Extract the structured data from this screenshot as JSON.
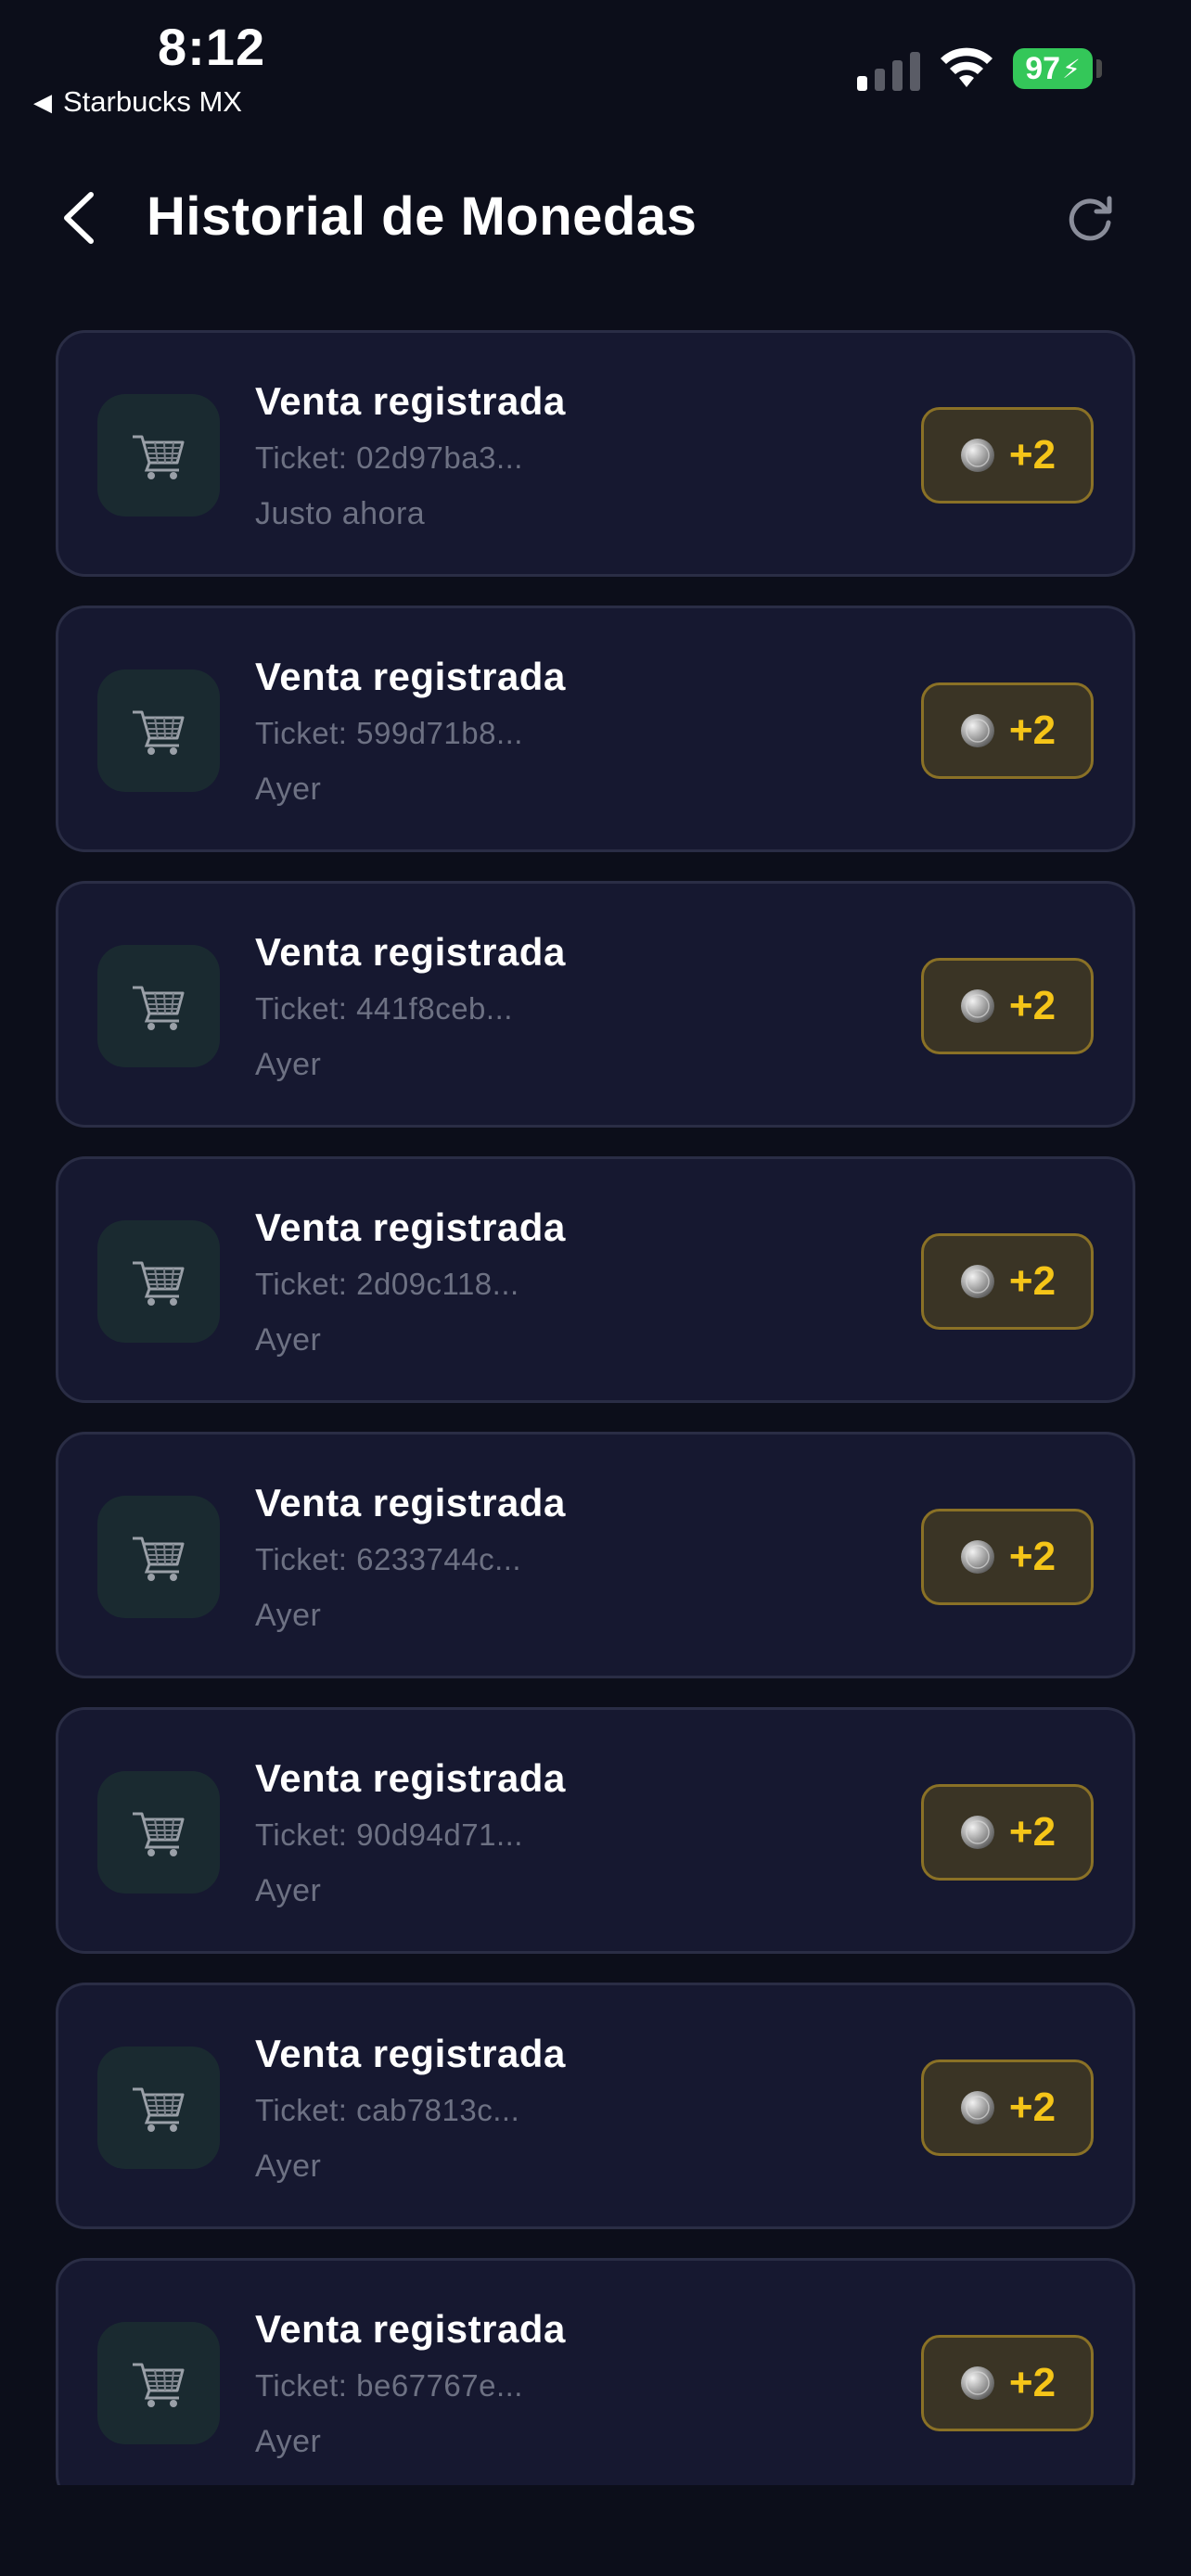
{
  "status_bar": {
    "time": "8:12",
    "back_app": "Starbucks MX",
    "battery": "97",
    "colors": {
      "battery": "#34c759"
    }
  },
  "header": {
    "title": "Historial de Monedas",
    "back_icon": "chevron-left-icon",
    "refresh_icon": "refresh-icon"
  },
  "transactions": [
    {
      "title": "Venta registrada",
      "ticket": "Ticket: 02d97ba3...",
      "time": "Justo ahora",
      "amount": "+2"
    },
    {
      "title": "Venta registrada",
      "ticket": "Ticket: 599d71b8...",
      "time": "Ayer",
      "amount": "+2"
    },
    {
      "title": "Venta registrada",
      "ticket": "Ticket: 441f8ceb...",
      "time": "Ayer",
      "amount": "+2"
    },
    {
      "title": "Venta registrada",
      "ticket": "Ticket: 2d09c118...",
      "time": "Ayer",
      "amount": "+2"
    },
    {
      "title": "Venta registrada",
      "ticket": "Ticket: 6233744c...",
      "time": "Ayer",
      "amount": "+2"
    },
    {
      "title": "Venta registrada",
      "ticket": "Ticket: 90d94d71...",
      "time": "Ayer",
      "amount": "+2"
    },
    {
      "title": "Venta registrada",
      "ticket": "Ticket: cab7813c...",
      "time": "Ayer",
      "amount": "+2"
    },
    {
      "title": "Venta registrada",
      "ticket": "Ticket: be67767e...",
      "time": "Ayer",
      "amount": "+2"
    }
  ],
  "icons": {
    "transaction": "shopping-cart-icon",
    "coin": "coin-icon"
  },
  "colors": {
    "background": "#0c0e1a",
    "card": "#161830",
    "coin_text": "#f5c518",
    "coin_badge": "#3a3425"
  }
}
